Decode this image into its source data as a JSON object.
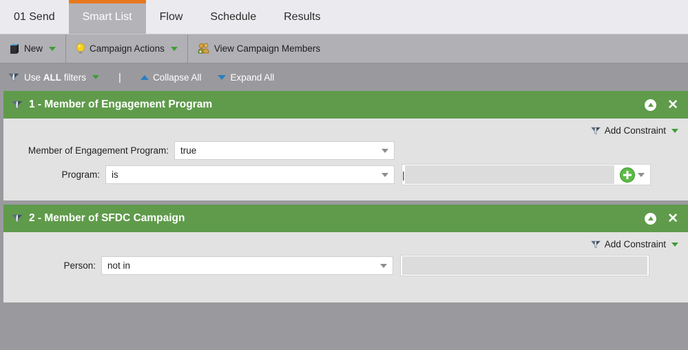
{
  "tabs": [
    {
      "label": "01 Send",
      "active": false
    },
    {
      "label": "Smart List",
      "active": true
    },
    {
      "label": "Flow",
      "active": false
    },
    {
      "label": "Schedule",
      "active": false
    },
    {
      "label": "Results",
      "active": false
    }
  ],
  "toolbar": {
    "new_label": "New",
    "campaign_actions_label": "Campaign Actions",
    "view_members_label": "View Campaign Members",
    "icons": {
      "new": "document-icon",
      "campaign_actions": "lightbulb-icon",
      "view_members": "people-icon"
    }
  },
  "filterbar": {
    "use_prefix": "Use ",
    "use_strong": "ALL",
    "use_suffix": " filters",
    "separator": "|",
    "collapse_all": "Collapse All",
    "expand_all": "Expand All"
  },
  "panels": [
    {
      "title": "1 - Member of Engagement Program",
      "add_constraint": "Add Constraint",
      "fields": [
        {
          "label": "Member of Engagement Program:",
          "value": "true",
          "type": "select"
        },
        {
          "label": "Program:",
          "value": "is",
          "type": "select-with-value",
          "input_value": ""
        }
      ]
    },
    {
      "title": "2 - Member of SFDC Campaign",
      "add_constraint": "Add Constraint",
      "fields": [
        {
          "label": "Person:",
          "value": "not in",
          "type": "select-plain",
          "input_value": ""
        }
      ]
    }
  ],
  "colors": {
    "accent_orange": "#e8781e",
    "panel_green": "#5f9b4b",
    "toolbar_gray": "#b0b0b5",
    "filterbar_gray": "#9a9a9e",
    "panel_body": "#e2e2e2",
    "plus_green": "#5cbb46",
    "triangle_blue": "#2b7ec1"
  }
}
